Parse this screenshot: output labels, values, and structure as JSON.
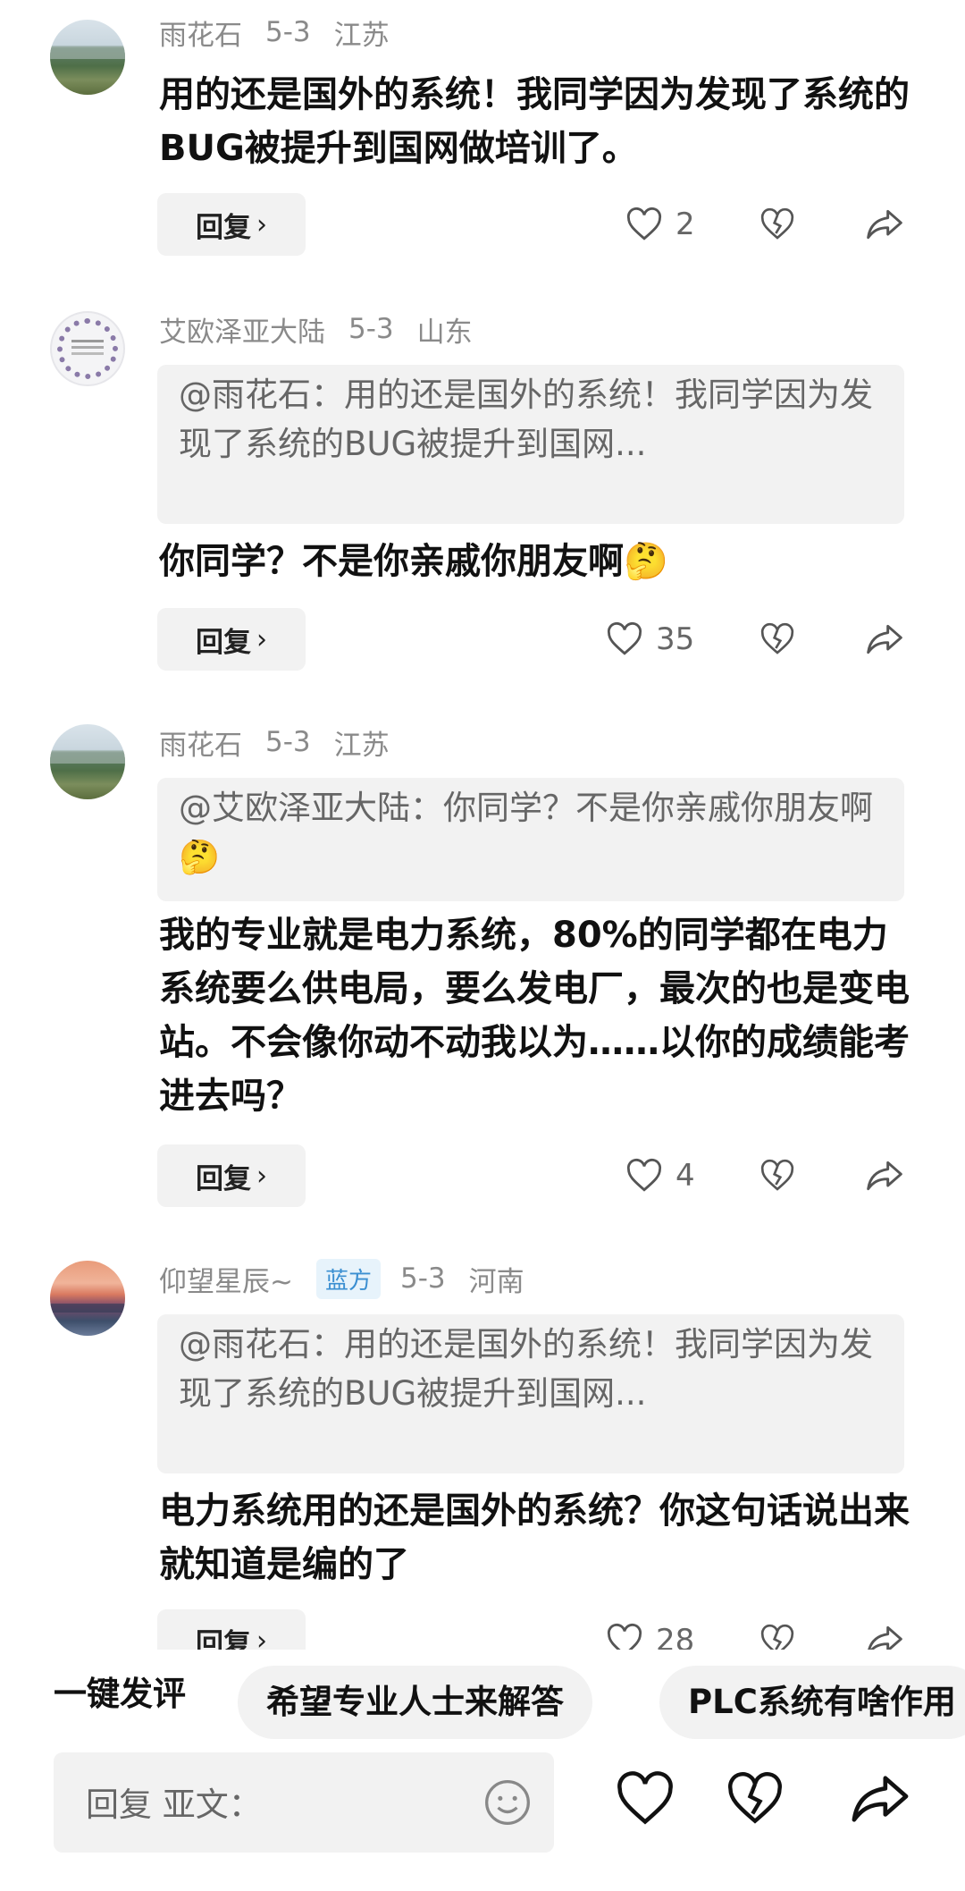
{
  "comments": [
    {
      "user": "雨花石",
      "date": "5-3",
      "location": "江苏",
      "quote": "",
      "text": "用的还是国外的系统！我同学因为发现了系统的BUG被提升到国网做培训了。",
      "reply_label": "回复",
      "likes": "2"
    },
    {
      "user": "艾欧泽亚大陆",
      "date": "5-3",
      "location": "山东",
      "quote": "@雨花石：用的还是国外的系统！我同学因为发现了系统的BUG被提升到国网...",
      "text": "你同学？不是你亲戚你朋友啊🤔",
      "reply_label": "回复",
      "likes": "35"
    },
    {
      "user": "雨花石",
      "date": "5-3",
      "location": "江苏",
      "quote": "@艾欧泽亚大陆：你同学？不是你亲戚你朋友啊🤔",
      "text": "我的专业就是电力系统，80%的同学都在电力系统要么供电局，要么发电厂，最次的也是变电站。不会像你动不动我以为……以你的成绩能考进去吗？",
      "reply_label": "回复",
      "likes": "4"
    },
    {
      "user": "仰望星辰~",
      "badge": "蓝方",
      "date": "5-3",
      "location": "河南",
      "quote": "@雨花石：用的还是国外的系统！我同学因为发现了系统的BUG被提升到国网...",
      "text": "电力系统用的还是国外的系统？你这句话说出来就知道是编的了",
      "reply_label": "回复",
      "likes": "28"
    }
  ],
  "suggest": {
    "label": "一键发评",
    "chips": [
      "希望专业人士来解答",
      "PLC系统有啥作用"
    ]
  },
  "input": {
    "placeholder": "回复 亚文："
  },
  "icons": {
    "like": "heart-icon",
    "dislike": "broken-heart-icon",
    "share": "share-arrow-icon",
    "emoji": "smiley-icon"
  }
}
